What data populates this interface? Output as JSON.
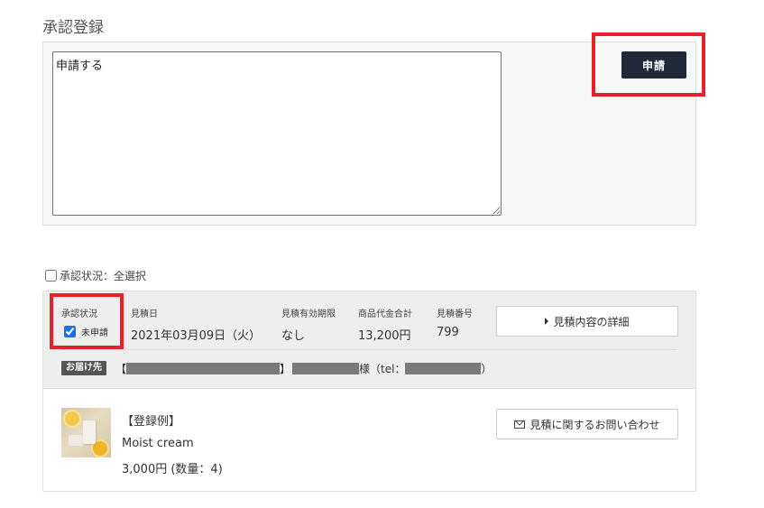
{
  "section_title": "承認登録",
  "comment": {
    "value": "申請する",
    "placeholder": ""
  },
  "submit_label": "申請",
  "select_all_label": "承認状況：全選択",
  "order": {
    "status_label": "承認状況",
    "status_value": "未申請",
    "status_checked": true,
    "estimate_date_label": "見積日",
    "estimate_date": "2021年03月09日（火）",
    "expiry_label": "見積有効期限",
    "expiry_value": "なし",
    "total_label": "商品代金合計",
    "total_value": "13,200円",
    "number_label": "見積番号",
    "number_value": "799",
    "detail_button": "見積内容の詳細",
    "shipping": {
      "badge": "お届け先",
      "open_bracket": "【",
      "close_bracket": "】",
      "honorific": "様（tel：",
      "close_paren": "）"
    }
  },
  "item": {
    "name_ja": "【登録例】",
    "name_en": "Moist cream",
    "price": "3,000円 (数量：4)",
    "inquiry_button": "見積に関するお問い合わせ"
  },
  "colors": {
    "submit_bg": "#222a3a",
    "highlight": "#e8202a",
    "badge_bg": "#555555",
    "redaction": "#7a7a7a"
  },
  "icons": [
    "caret-right-icon",
    "mail-icon"
  ]
}
